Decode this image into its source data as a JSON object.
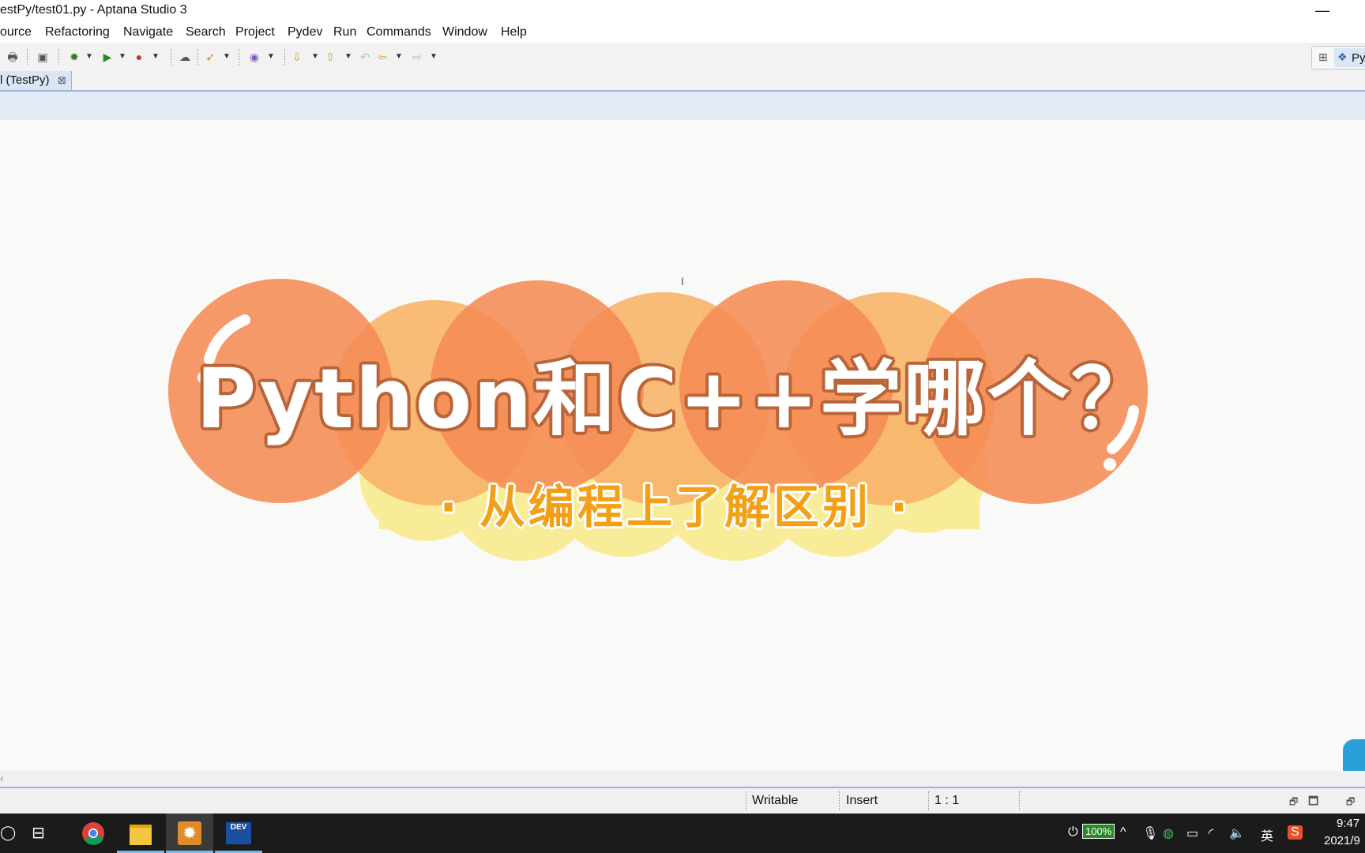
{
  "window": {
    "title": "estPy/test01.py - Aptana Studio 3",
    "minimize": "—"
  },
  "menu": [
    "ource",
    "Refactoring",
    "Navigate",
    "Search",
    "Project",
    "Pydev",
    "Run",
    "Commands",
    "Window",
    "Help"
  ],
  "perspective": {
    "label": "Py"
  },
  "editor_tab": {
    "label": "l (TestPy)",
    "close": "⊠"
  },
  "banner": {
    "title": "Python和C++学哪个？",
    "subtitle": "· 从编程上了解区别 ·"
  },
  "status": {
    "writable": "Writable",
    "insert": "Insert",
    "position": "1 : 1"
  },
  "taskbar": {
    "apps": [
      "chrome-icon",
      "file-explorer-icon",
      "aptana-icon",
      "dev-cpp-icon"
    ],
    "dev_label": "DEV",
    "battery": "100%",
    "ime": "英",
    "time": "9:47",
    "date": "2021/9"
  },
  "colors": {
    "orange": "#f58b55",
    "light_orange": "#f7b469",
    "yellow": "#f9ec93",
    "subtitle": "#f2a018",
    "tab_blue": "#dbe6f4"
  }
}
